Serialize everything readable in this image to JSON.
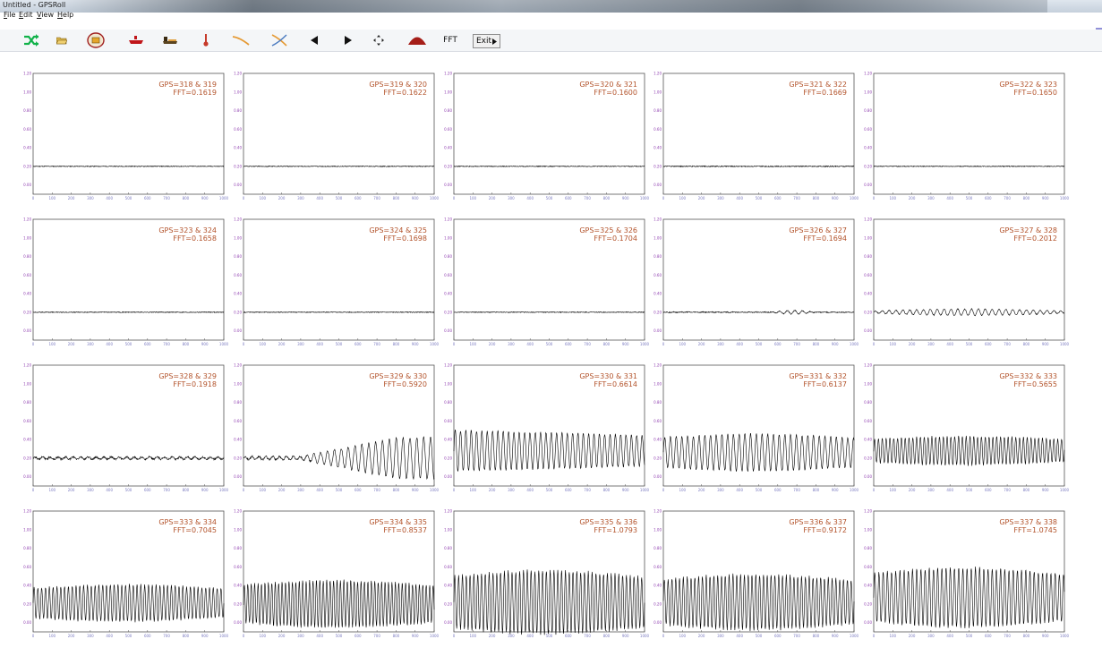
{
  "window": {
    "title": "Untitled - GPSRoll"
  },
  "menu": [
    {
      "label": "File",
      "u": "F",
      "rest": "ile"
    },
    {
      "label": "Edit",
      "u": "E",
      "rest": "dit"
    },
    {
      "label": "View",
      "u": "V",
      "rest": "iew"
    },
    {
      "label": "Help",
      "u": "H",
      "rest": "elp"
    }
  ],
  "toolbar": {
    "icons": [
      "shuffle-icon",
      "open-folder-icon",
      "disc-icon",
      "red-hull-icon",
      "ship-icon",
      "thermometer-icon",
      "curve-icon",
      "cross-curve-icon",
      "arrow-left-icon",
      "arrow-right-icon",
      "move-icon",
      "dome-icon"
    ],
    "fft_label": "FFT",
    "exit_label": "Exit"
  },
  "colors": {
    "label": "#b3532b",
    "ytick": "#8f3fb0",
    "xtick": "#7a7ac0",
    "trace": "#000000"
  },
  "chart_data": [
    {
      "type": "line",
      "gps": "GPS=318 & 319",
      "fft": "FFT=0.1619",
      "mode": "flat",
      "amp": 0.004,
      "period": 0,
      "growth": 0,
      "noise": 0.004,
      "center": 0.2
    },
    {
      "type": "line",
      "gps": "GPS=319 & 320",
      "fft": "FFT=0.1622",
      "mode": "flat",
      "amp": 0.004,
      "period": 0,
      "growth": 0,
      "noise": 0.004,
      "center": 0.2
    },
    {
      "type": "line",
      "gps": "GPS=320 & 321",
      "fft": "FFT=0.1600",
      "mode": "flat",
      "amp": 0.004,
      "period": 0,
      "growth": 0,
      "noise": 0.004,
      "center": 0.2
    },
    {
      "type": "line",
      "gps": "GPS=321 & 322",
      "fft": "FFT=0.1669",
      "mode": "flat",
      "amp": 0.004,
      "period": 0,
      "growth": 0,
      "noise": 0.005,
      "center": 0.2
    },
    {
      "type": "line",
      "gps": "GPS=322 & 323",
      "fft": "FFT=0.1650",
      "mode": "flat",
      "amp": 0.004,
      "period": 0,
      "growth": 0,
      "noise": 0.004,
      "center": 0.2
    },
    {
      "type": "line",
      "gps": "GPS=323 & 324",
      "fft": "FFT=0.1658",
      "mode": "flat",
      "amp": 0.004,
      "period": 0,
      "growth": 0,
      "noise": 0.004,
      "center": 0.2
    },
    {
      "type": "line",
      "gps": "GPS=324 & 325",
      "fft": "FFT=0.1698",
      "mode": "flat",
      "amp": 0.004,
      "period": 0,
      "growth": 0,
      "noise": 0.004,
      "center": 0.2
    },
    {
      "type": "line",
      "gps": "GPS=325 & 326",
      "fft": "FFT=0.1704",
      "mode": "flat",
      "amp": 0.004,
      "period": 0,
      "growth": 0,
      "noise": 0.004,
      "center": 0.2
    },
    {
      "type": "line",
      "gps": "GPS=326 & 327",
      "fft": "FFT=0.1694",
      "mode": "bump",
      "amp": 0.02,
      "period": 40,
      "growth": 0,
      "noise": 0.005,
      "center": 0.2
    },
    {
      "type": "line",
      "gps": "GPS=327 & 328",
      "fft": "FFT=0.2012",
      "mode": "grow",
      "amp": 0.035,
      "period": 36,
      "growth": 0,
      "noise": 0.005,
      "center": 0.2
    },
    {
      "type": "line",
      "gps": "GPS=328 & 329",
      "fft": "FFT=0.1918",
      "mode": "flat",
      "amp": 0.012,
      "period": 40,
      "growth": 0,
      "noise": 0.01,
      "center": 0.2
    },
    {
      "type": "line",
      "gps": "GPS=329 & 330",
      "fft": "FFT=0.5920",
      "mode": "ramp",
      "amp": 0.22,
      "period": 36,
      "growth": 0,
      "noise": 0.01,
      "center": 0.2
    },
    {
      "type": "line",
      "gps": "GPS=330 & 331",
      "fft": "FFT=0.6614",
      "mode": "decay",
      "amp": 0.22,
      "period": 28,
      "growth": 0,
      "noise": 0.01,
      "center": 0.28
    },
    {
      "type": "line",
      "gps": "GPS=331 & 332",
      "fft": "FFT=0.6137",
      "mode": "steady",
      "amp": 0.18,
      "period": 30,
      "growth": 0,
      "noise": 0.01,
      "center": 0.26
    },
    {
      "type": "line",
      "gps": "GPS=332 & 333",
      "fft": "FFT=0.5655",
      "mode": "steady",
      "amp": 0.14,
      "period": 20,
      "growth": 0,
      "noise": 0.01,
      "center": 0.28
    },
    {
      "type": "line",
      "gps": "GPS=333 & 334",
      "fft": "FFT=0.7045",
      "mode": "steady",
      "amp": 0.18,
      "period": 20,
      "growth": 0,
      "noise": 0.01,
      "center": 0.21
    },
    {
      "type": "line",
      "gps": "GPS=334 & 335",
      "fft": "FFT=0.8537",
      "mode": "steady",
      "amp": 0.23,
      "period": 18,
      "growth": 0,
      "noise": 0.012,
      "center": 0.2
    },
    {
      "type": "line",
      "gps": "GPS=335 & 336",
      "fft": "FFT=1.0793",
      "mode": "steady",
      "amp": 0.31,
      "period": 20,
      "growth": 0,
      "noise": 0.015,
      "center": 0.22
    },
    {
      "type": "line",
      "gps": "GPS=336 & 337",
      "fft": "FFT=0.9172",
      "mode": "steady",
      "amp": 0.27,
      "period": 20,
      "growth": 0,
      "noise": 0.015,
      "center": 0.22
    },
    {
      "type": "line",
      "gps": "GPS=337 & 338",
      "fft": "FFT=1.0745",
      "mode": "steady",
      "amp": 0.29,
      "period": 22,
      "growth": 0,
      "noise": 0.015,
      "center": 0.27
    }
  ],
  "axes": {
    "x_ticks": [
      "0",
      "100",
      "200",
      "300",
      "400",
      "500",
      "600",
      "700",
      "800",
      "900",
      "1000"
    ],
    "y_ticks": [
      "1.20",
      "1.00",
      "0.80",
      "0.60",
      "0.40",
      "0.20",
      "0.00"
    ],
    "xlim": [
      0,
      1000
    ],
    "ylim": [
      -0.1,
      1.2
    ]
  }
}
